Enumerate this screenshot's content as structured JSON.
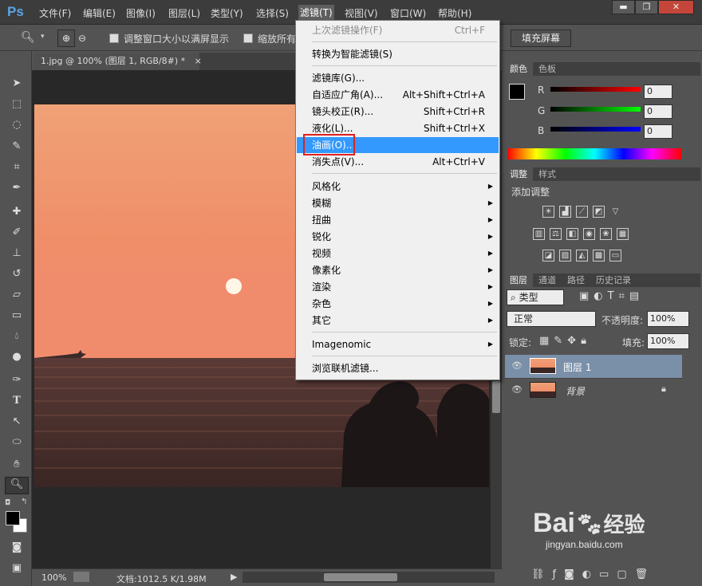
{
  "app": {
    "logo": "Ps"
  },
  "menubar": {
    "items": [
      "文件(F)",
      "编辑(E)",
      "图像(I)",
      "图层(L)",
      "类型(Y)",
      "选择(S)",
      "滤镜(T)",
      "视图(V)",
      "窗口(W)",
      "帮助(H)"
    ],
    "active": "滤镜(T)"
  },
  "window_controls": {
    "minimize": "▬",
    "restore": "❐",
    "close": "✕"
  },
  "options_bar": {
    "resize_windows": "调整窗口大小以满屏显示",
    "zoom_all": "缩放所有",
    "fill_screen": "填充屏幕"
  },
  "document": {
    "tab_title": "1.jpg @ 100% (图层 1, RGB/8#) *",
    "tab_close": "×"
  },
  "filter_menu": {
    "last_filter": {
      "label": "上次滤镜操作(F)",
      "shortcut": "Ctrl+F"
    },
    "smart_filter": "转换为智能滤镜(S)",
    "group1": [
      {
        "label": "滤镜库(G)...",
        "shortcut": ""
      },
      {
        "label": "自适应广角(A)...",
        "shortcut": "Alt+Shift+Ctrl+A"
      },
      {
        "label": "镜头校正(R)...",
        "shortcut": "Shift+Ctrl+R"
      },
      {
        "label": "液化(L)...",
        "shortcut": "Shift+Ctrl+X"
      },
      {
        "label": "油画(O)...",
        "shortcut": ""
      },
      {
        "label": "消失点(V)...",
        "shortcut": "Alt+Ctrl+V"
      }
    ],
    "submenus": [
      "风格化",
      "模糊",
      "扭曲",
      "锐化",
      "视频",
      "像素化",
      "渲染",
      "杂色",
      "其它"
    ],
    "plugin": "Imagenomic",
    "browse_online": "浏览联机滤镜..."
  },
  "status": {
    "zoom": "100%",
    "doc_size": "文档:1012.5 K/1.98M"
  },
  "color_panel": {
    "tabs": [
      "颜色",
      "色板"
    ],
    "channels": [
      {
        "name": "R",
        "value": "0"
      },
      {
        "name": "G",
        "value": "0"
      },
      {
        "name": "B",
        "value": "0"
      }
    ]
  },
  "adjust_panel": {
    "tabs": [
      "调整",
      "样式"
    ],
    "title": "添加调整"
  },
  "layers_panel": {
    "tabs": [
      "图层",
      "通道",
      "路径",
      "历史记录"
    ],
    "kind_filter": "类型",
    "blend_mode": "正常",
    "opacity_label": "不透明度:",
    "opacity_value": "100%",
    "lock_label": "锁定:",
    "fill_label": "填充:",
    "fill_value": "100%",
    "layers": [
      {
        "name": "图层 1",
        "selected": true,
        "locked": false
      },
      {
        "name": "背景",
        "selected": false,
        "locked": true
      }
    ]
  },
  "watermark": {
    "brand": "Bai",
    "brand_suffix": "经验",
    "url": "jingyan.baidu.com"
  },
  "colors": {
    "highlight": "#3399ff",
    "red_box": "#e02020",
    "logo": "#5ba4e6"
  }
}
